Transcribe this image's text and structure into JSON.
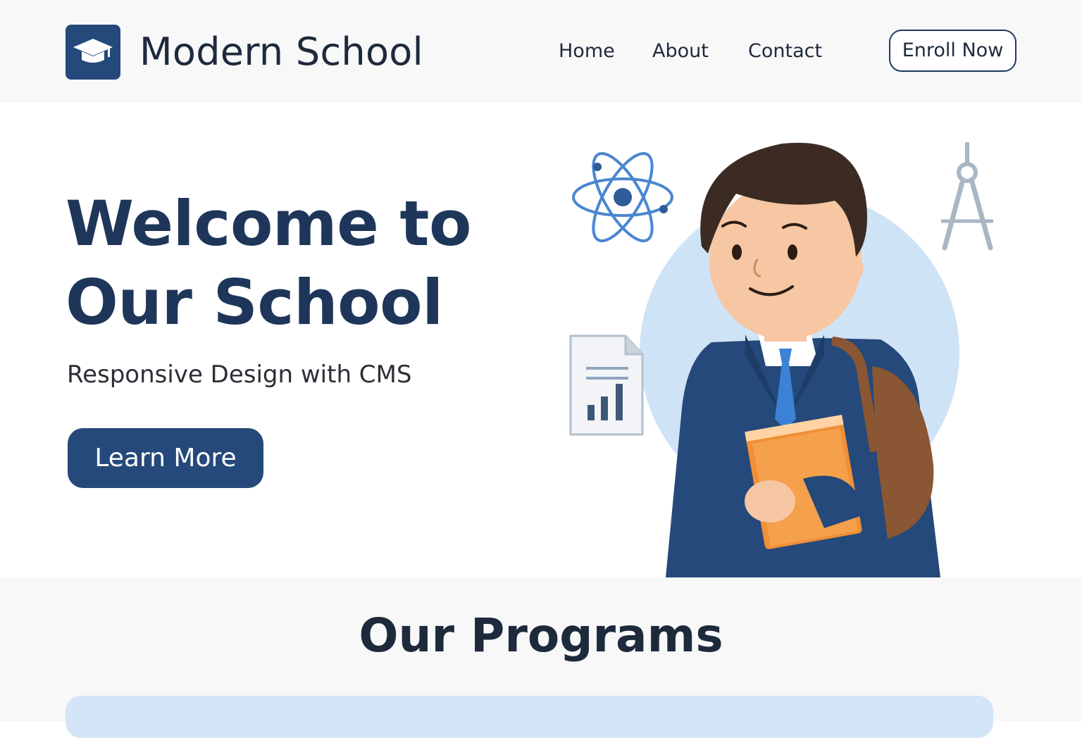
{
  "header": {
    "logo_icon": "graduation-cap-icon",
    "brand": "Modern School",
    "nav": [
      {
        "label": "Home"
      },
      {
        "label": "About"
      },
      {
        "label": "Contact"
      }
    ],
    "cta_label": "Enroll Now"
  },
  "hero": {
    "title_line1": "Welcome to",
    "title_line2": "Our School",
    "subtitle": "Responsive Design with CMS",
    "button_label": "Learn More",
    "illustration_icons": [
      "atom-icon",
      "compass-icon",
      "report-document-icon",
      "student-illustration"
    ]
  },
  "programs": {
    "title": "Our Programs"
  },
  "colors": {
    "primary": "#24497a",
    "heading": "#1e3659",
    "accent_light": "#d3e5f7",
    "background_alt": "#f8f8f9"
  }
}
